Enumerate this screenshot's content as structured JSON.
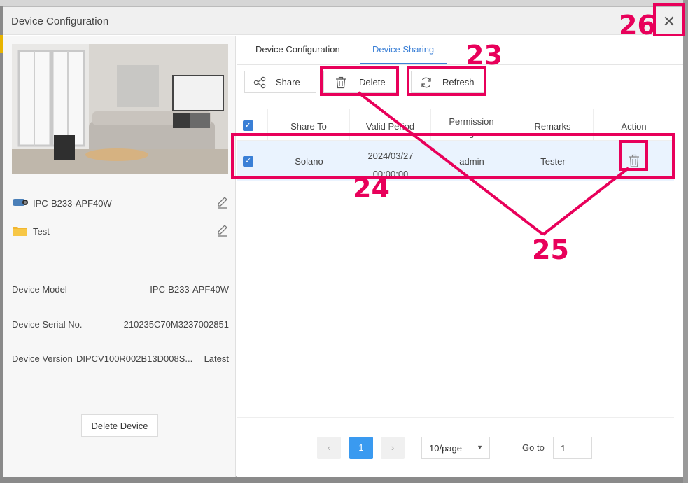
{
  "dialog": {
    "title": "Device Configuration",
    "close_glyph": "✕"
  },
  "left": {
    "device_name": "IPC-B233-APF40W",
    "folder_name": "Test",
    "info": [
      {
        "key": "Device Model",
        "value": "IPC-B233-APF40W"
      },
      {
        "key": "Device Serial No.",
        "value": "210235C70M3237002851"
      },
      {
        "key": "Device Version",
        "value": "DIPCV100R002B13D008S...",
        "extra": "Latest"
      }
    ],
    "delete_device_label": "Delete Device"
  },
  "tabs": [
    {
      "label": "Device Configuration"
    },
    {
      "label": "Device Sharing"
    }
  ],
  "toolbar": {
    "share_label": "Share",
    "delete_label": "Delete",
    "refresh_label": "Refresh"
  },
  "table": {
    "headers": {
      "share_to": "Share To",
      "valid_period": "Valid Period",
      "permissions_1": "Permission",
      "permissions_2": "s",
      "remarks": "Remarks",
      "action": "Action"
    },
    "rows": [
      {
        "share_to": "Solano",
        "date": "2024/03/27",
        "time": "00:00:00",
        "permissions": "admin",
        "remarks": "Tester"
      }
    ]
  },
  "pagination": {
    "prev": "‹",
    "next": "›",
    "current_page": "1",
    "page_size": "10/page",
    "goto_label": "Go to",
    "goto_value": "1"
  },
  "callouts": {
    "c23": "23",
    "c24": "24",
    "c25": "25",
    "c26": "26"
  },
  "colors": {
    "accent": "#3a7fd6",
    "highlight": "#e8005a"
  },
  "icons": [
    "camera-icon",
    "folder-icon",
    "edit-icon",
    "share-icon",
    "trash-icon",
    "refresh-icon",
    "checkbox-icon",
    "close-icon"
  ]
}
